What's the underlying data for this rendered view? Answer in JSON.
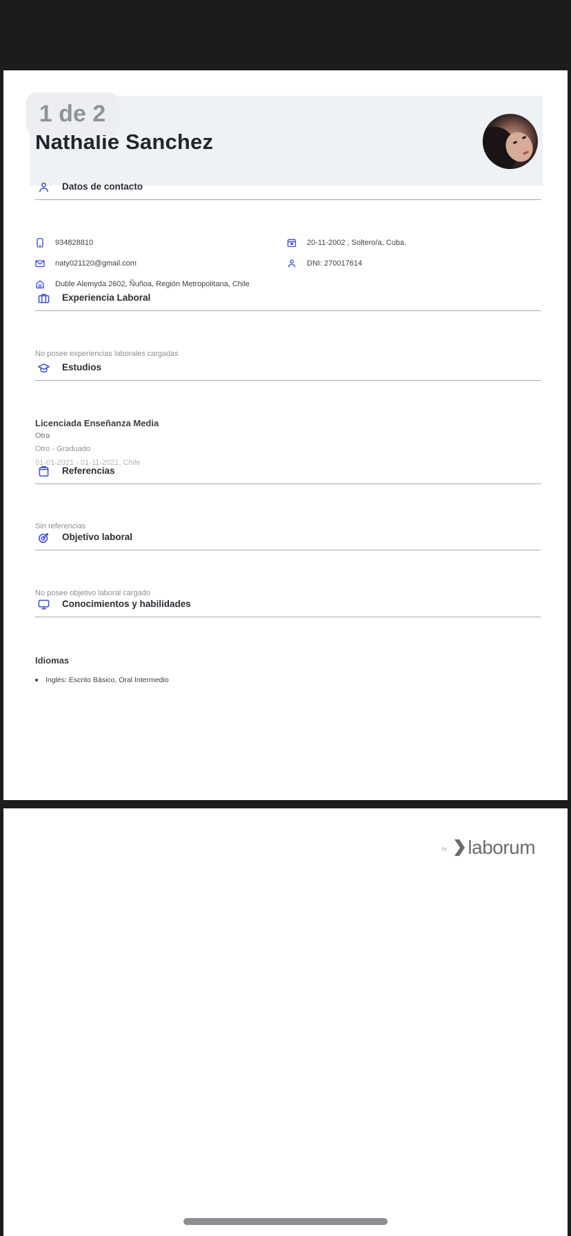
{
  "viewer": {
    "page_counter": "1 de 2"
  },
  "profile": {
    "name": "Nathalie Sanchez"
  },
  "sections": {
    "contact": {
      "title": "Datos de contacto",
      "phone": "934828810",
      "email": "naty021120@gmail.com",
      "address": "Duble Alemyda 2602, Ñuñoa, Región Metropolitana, Chile",
      "birth": "20-11-2002 , Soltero/a, Cuba.",
      "dni": "DNI: 270017614"
    },
    "experience": {
      "title": "Experiencia Laboral",
      "empty": "No posee experiencias laborales cargadas"
    },
    "studies": {
      "title": "Estudios",
      "items": [
        {
          "degree": "Licenciada Enseñanza Media",
          "institution": "Otra",
          "level": "Otro - Graduado",
          "dates": "01-01-2021 - 01-11-2021, Chile"
        }
      ]
    },
    "references": {
      "title": "Referencias",
      "empty": "Sin referencias"
    },
    "objective": {
      "title": "Objetivo laboral",
      "empty": "No posee objetivo laboral cargado"
    },
    "skills": {
      "title": "Conocimientos y habilidades",
      "languages_title": "Idiomas",
      "languages": [
        "Inglés: Escrito Básico, Oral Intermedio"
      ]
    }
  },
  "branding": {
    "by": "by",
    "logo": "laborum"
  },
  "icons": {
    "contact": "person-icon",
    "phone": "phone-icon",
    "email": "mail-icon",
    "address": "home-icon",
    "birth": "calendar-icon",
    "dni": "person-icon",
    "experience": "briefcase-icon",
    "studies": "graduation-cap-icon",
    "references": "clipboard-icon",
    "objective": "target-icon",
    "skills": "monitor-icon"
  },
  "colors": {
    "accent": "#3a4bd8",
    "header_band": "#eef1f6",
    "backdrop": "#1c1c1e"
  }
}
